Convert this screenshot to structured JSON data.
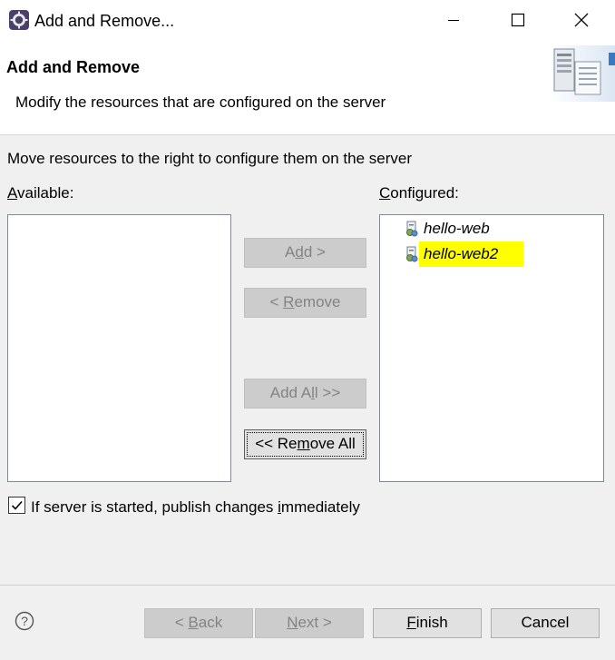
{
  "window": {
    "title": "Add and Remove...",
    "icon": "eclipse-server-icon",
    "controls": [
      "minimize-icon",
      "maximize-icon",
      "close-icon"
    ]
  },
  "banner": {
    "title": "Add and Remove",
    "description": "Modify the resources that are configured on the server",
    "image": "server-illustration-icon"
  },
  "instruction": "Move resources to the right to configure them on the server",
  "available": {
    "label_mnemonic": "A",
    "label_rest": "vailable:",
    "items": []
  },
  "configured": {
    "label_mnemonic": "C",
    "label_rest": "onfigured:",
    "items": [
      {
        "label": "hello-web",
        "icon": "web-module-icon",
        "selected": false
      },
      {
        "label": "hello-web2",
        "icon": "web-module-icon",
        "selected": true
      }
    ],
    "selection_color": "#ffff00"
  },
  "buttons": {
    "add": {
      "pre": "A",
      "mn": "d",
      "post": "d >"
    },
    "remove": {
      "pre": "< ",
      "mn": "R",
      "post": "emove"
    },
    "add_all": {
      "pre": "Add A",
      "mn": "l",
      "post": "l >>"
    },
    "remove_all": {
      "pre": "<< Re",
      "mn": "m",
      "post": "ove All"
    }
  },
  "publish": {
    "checked": true,
    "pre": "If server is started, publish changes ",
    "mn": "i",
    "post": "mmediately"
  },
  "footer": {
    "help": "?",
    "back": {
      "pre": "< ",
      "mn": "B",
      "post": "ack"
    },
    "next": {
      "pre": "",
      "mn": "N",
      "post": "ext >"
    },
    "finish": {
      "pre": "",
      "mn": "F",
      "post": "inish"
    },
    "cancel": "Cancel"
  }
}
